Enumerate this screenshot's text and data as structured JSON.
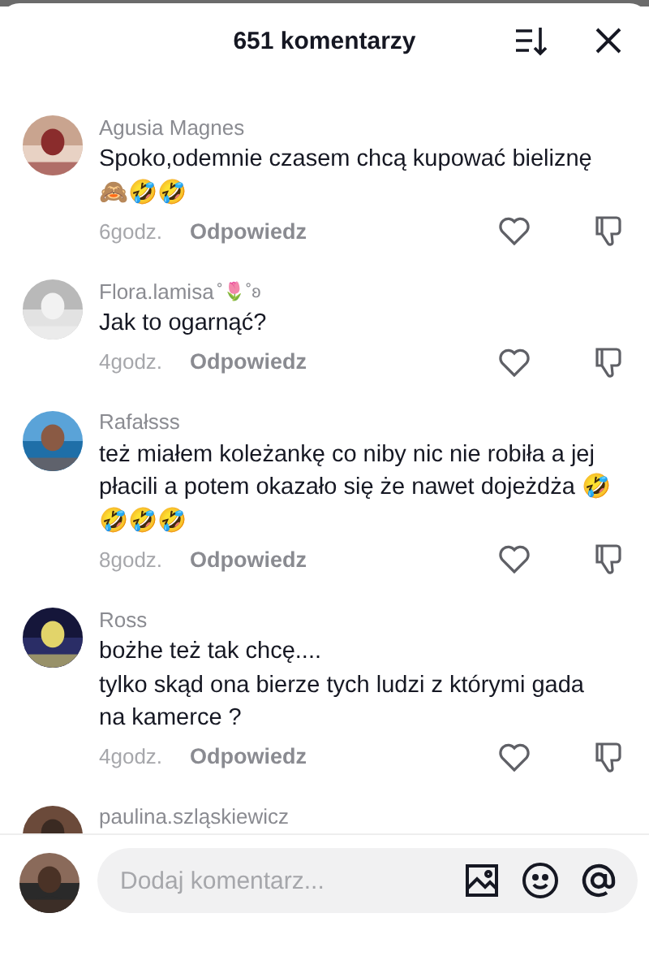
{
  "header": {
    "title": "651 komentarzy"
  },
  "comments": [
    {
      "author": "Agusia Magnes",
      "text": "Spoko,odemnie czasem chcą kupować bieliznę\n🙈🤣🤣",
      "time": "6godz.",
      "reply": "Odpowiedz"
    },
    {
      "author": "Flora.lamisa",
      "badge": "˚🌷˚ʚ",
      "text": "Jak to ogarnąć?",
      "time": "4godz.",
      "reply": "Odpowiedz"
    },
    {
      "author": "Rafałsss",
      "text": "też miałem koleżankę co niby nic nie robiła a jej\npłacili a potem okazało się że nawet dojeżdża 🤣\n🤣🤣🤣",
      "time": "8godz.",
      "reply": "Odpowiedz"
    },
    {
      "author": "Ross",
      "text": "bożhe też tak chcę....\ntylko skąd ona bierze tych ludzi z którymi gada\nna kamerce ?",
      "time": "4godz.",
      "reply": "Odpowiedz"
    },
    {
      "author": "paulina.szląskiewicz"
    }
  ],
  "composer": {
    "placeholder": "Dodaj komentarz..."
  }
}
